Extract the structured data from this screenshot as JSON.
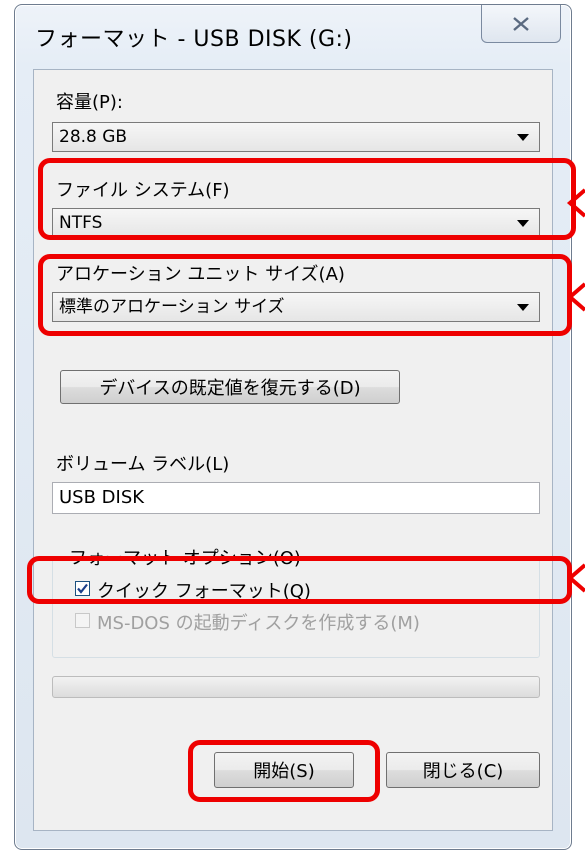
{
  "window": {
    "title": "フォーマット - USB DISK (G:)",
    "close_icon": "close-x-icon"
  },
  "capacity": {
    "label": "容量(P):",
    "value": "28.8 GB"
  },
  "file_system": {
    "label": "ファイル システム(F)",
    "value": "NTFS"
  },
  "allocation": {
    "label": "アロケーション ユニット サイズ(A)",
    "value": "標準のアロケーション サイズ"
  },
  "restore_defaults_button": "デバイスの既定値を復元する(D)",
  "volume_label": {
    "label": "ボリューム ラベル(L)",
    "value": "USB DISK"
  },
  "format_options": {
    "title": "フォーマット オプション(O)",
    "quick_format": {
      "label": "クイック フォーマット(Q)",
      "checked": true
    },
    "msdos_startup": {
      "label": "MS-DOS の起動ディスクを作成する(M)",
      "checked": false,
      "enabled": false
    }
  },
  "progress": {
    "fraction": 0
  },
  "buttons": {
    "start": "開始(S)",
    "close": "閉じる(C)"
  },
  "colors": {
    "highlight": "#ee0000",
    "accent": "#1c5180"
  }
}
